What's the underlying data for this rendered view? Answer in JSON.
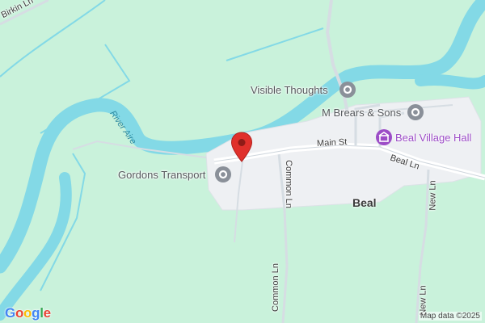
{
  "map": {
    "colors": {
      "land": "#c9f2db",
      "water": "#83d9e6",
      "built": "#eef0f3",
      "road": "#ffffff",
      "minor_road": "#d6dde3",
      "marker": "#e0302b",
      "poi": "#8a9099",
      "hall": "#9c4dc7"
    },
    "roads": {
      "birkin_ln": "Birkin Ln",
      "main_st": "Main St",
      "beal_ln": "Beal Ln",
      "common_ln_upper": "Common Ln",
      "common_ln_lower": "Common Ln",
      "new_ln_upper": "New Ln",
      "new_ln_lower": "New Ln"
    },
    "water": {
      "river_aire": "River Aire"
    },
    "town": {
      "name": "Beal"
    },
    "pois": {
      "visible_thoughts": "Visible Thoughts",
      "m_brears": "M Brears & Sons",
      "beal_village_hall": "Beal Village Hall",
      "gordons_transport": "Gordons Transport"
    },
    "icons": {
      "marker": "red-location-pin",
      "poi": "grey-poi-pin",
      "hall": "purple-civic-building-pin"
    },
    "logo": {
      "letters": [
        "G",
        "o",
        "o",
        "g",
        "l",
        "e"
      ],
      "colors": [
        "#4285F4",
        "#EA4335",
        "#FBBC05",
        "#4285F4",
        "#34A853",
        "#EA4335"
      ]
    },
    "attribution": "Map data ©2025"
  }
}
